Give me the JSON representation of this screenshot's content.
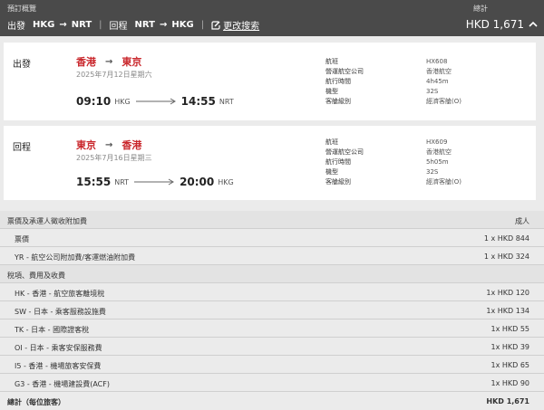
{
  "header": {
    "caption": "預訂概覽",
    "outbound_label": "出發",
    "outbound_from": "HKG",
    "outbound_to": "NRT",
    "return_label": "回程",
    "return_from": "NRT",
    "return_to": "HKG",
    "edit_label": "更改搜索",
    "total_caption": "總計",
    "total_value": "HKD 1,671"
  },
  "outbound": {
    "label": "出發",
    "from_city": "香港",
    "to_city": "東京",
    "date": "2025年7月12日星期六",
    "dep_time": "09:10",
    "dep_code": "HKG",
    "arr_time": "14:55",
    "arr_code": "NRT",
    "details": [
      {
        "k": "航班",
        "v": "HX608"
      },
      {
        "k": "營運航空公司",
        "v": "香港航空"
      },
      {
        "k": "航行時間",
        "v": "4h45m"
      },
      {
        "k": "機型",
        "v": "32S"
      },
      {
        "k": "客艙級別",
        "v": "經濟客艙(O)"
      }
    ]
  },
  "return": {
    "label": "回程",
    "from_city": "東京",
    "to_city": "香港",
    "date": "2025年7月16日星期三",
    "dep_time": "15:55",
    "dep_code": "NRT",
    "arr_time": "20:00",
    "arr_code": "HKG",
    "details": [
      {
        "k": "航班",
        "v": "HX609"
      },
      {
        "k": "營運航空公司",
        "v": "香港航空"
      },
      {
        "k": "航行時間",
        "v": "5h05m"
      },
      {
        "k": "機型",
        "v": "32S"
      },
      {
        "k": "客艙級別",
        "v": "經濟客艙(O)"
      }
    ]
  },
  "price": {
    "fare_section": "票價及承運人徵收附加費",
    "fare_section_col": "成人",
    "fare": {
      "l": "票價",
      "v": "1 x HKD  844"
    },
    "yr": {
      "l": "YR - 航空公司附加費/客運燃油附加費",
      "v": "1 x HKD  324"
    },
    "tax_section": "稅項、費用及收費",
    "taxes": [
      {
        "l": "HK - 香港 - 航空旅客離境稅",
        "v": "1x HKD  120"
      },
      {
        "l": "SW - 日本 - 乘客服務設施費",
        "v": "1x HKD  134"
      },
      {
        "l": "TK - 日本 - 國際證客稅",
        "v": "1x HKD  55"
      },
      {
        "l": "OI - 日本 - 乘客安保服務費",
        "v": "1x HKD  39"
      },
      {
        "l": "I5 - 香港 - 機場旅客安保費",
        "v": "1x HKD  65"
      },
      {
        "l": "G3 - 香港 - 機場建設費(ACF)",
        "v": "1x HKD  90"
      }
    ],
    "total_label": "總計（每位旅客）",
    "total_value": "HKD  1,671"
  },
  "colors": {
    "header_bg": "#4a4a4a",
    "city_red": "#c9262b"
  }
}
